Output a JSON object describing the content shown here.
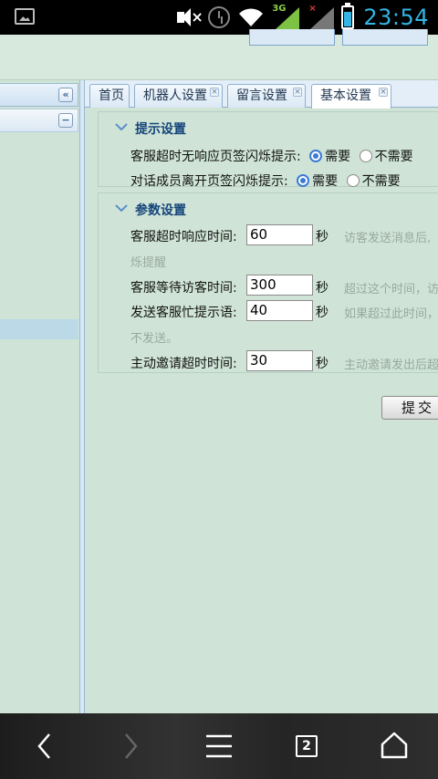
{
  "statusbar": {
    "network_type": "3G",
    "time": "23:54"
  },
  "sidebar": {
    "collapse_glyph": "«",
    "minus_glyph": "−"
  },
  "tabs": [
    {
      "label": "首页",
      "closable": false
    },
    {
      "label": "机器人设置",
      "closable": true
    },
    {
      "label": "留言设置",
      "closable": true
    },
    {
      "label": "基本设置",
      "closable": true,
      "active": true
    }
  ],
  "tips_section": {
    "title": "提示设置",
    "rows": [
      {
        "label": "客服超时无响应页签闪烁提示:",
        "options": [
          "需要",
          "不需要"
        ],
        "selected": "需要"
      },
      {
        "label": "对话成员离开页签闪烁提示:",
        "options": [
          "需要",
          "不需要"
        ],
        "selected": "需要"
      }
    ]
  },
  "params_section": {
    "title": "参数设置",
    "fields": [
      {
        "label": "客服超时响应时间:",
        "value": "60",
        "unit": "秒",
        "hint": "访客发送消息后,",
        "hint_cont": "烁提醒"
      },
      {
        "label": "客服等待访客时间:",
        "value": "300",
        "unit": "秒",
        "hint": "超过这个时间，访"
      },
      {
        "label": "发送客服忙提示语:",
        "value": "40",
        "unit": "秒",
        "hint": "如果超过此时间，",
        "hint_cont": "不发送。"
      },
      {
        "label": "主动邀请超时时间:",
        "value": "30",
        "unit": "秒",
        "hint": "主动邀请发出后超"
      }
    ]
  },
  "submit_label": "提交",
  "navbar": {
    "tab_count": "2"
  },
  "colors": {
    "accent": "#33b5e5",
    "section_title": "#15447a",
    "background": "#cfe4d6"
  }
}
